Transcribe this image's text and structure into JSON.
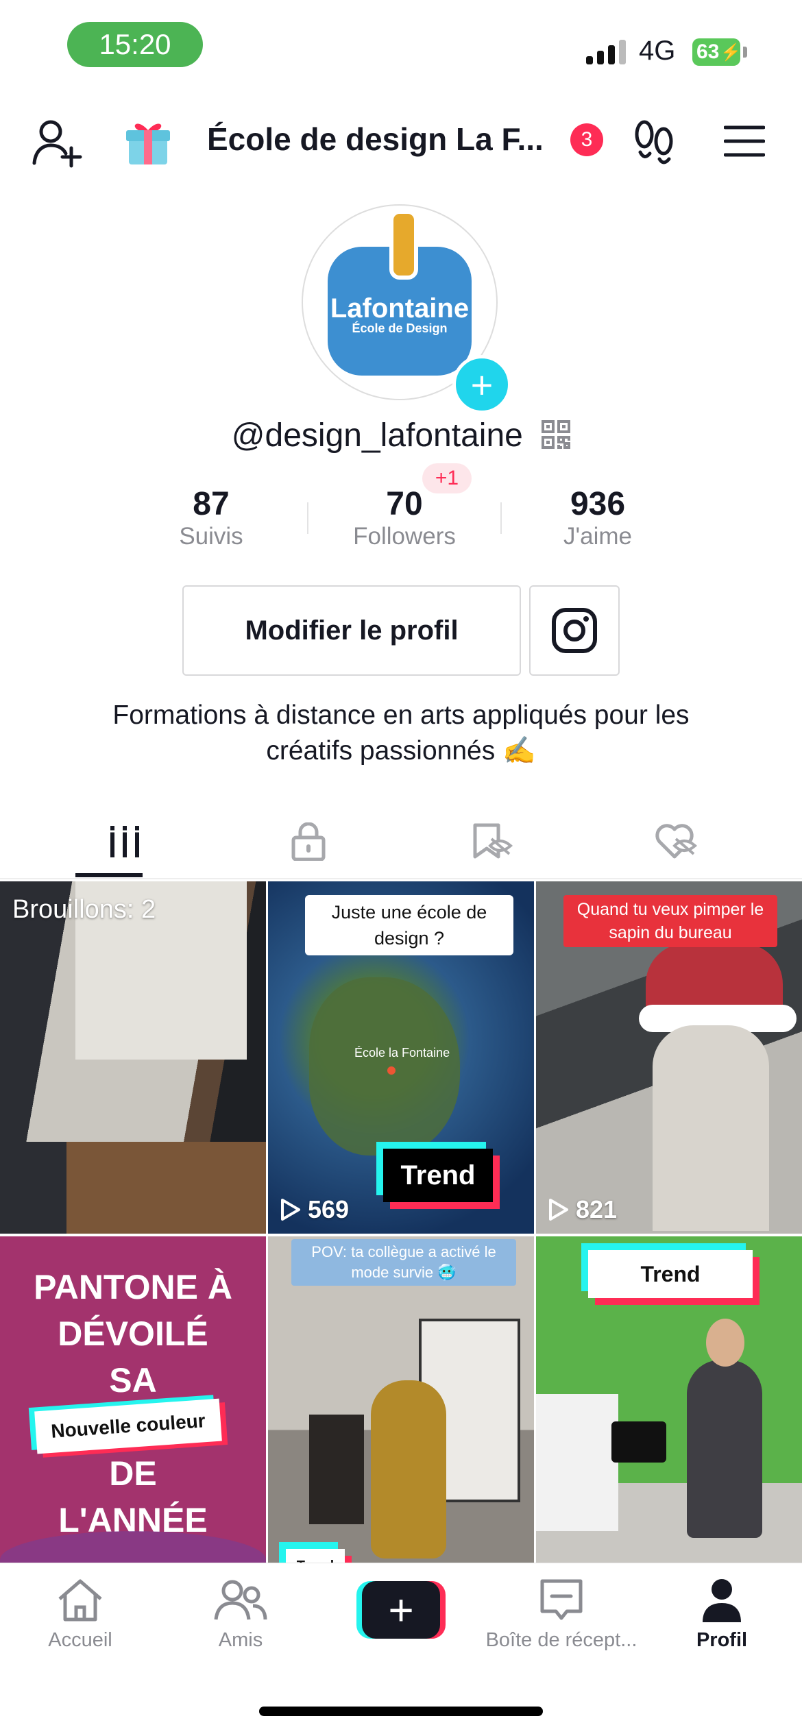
{
  "status_bar": {
    "time": "15:20",
    "network": "4G",
    "battery": "63"
  },
  "header": {
    "title": "École de design La F...",
    "notification_count": "3"
  },
  "profile": {
    "logo_name": "Lafontaine",
    "logo_sub": "École de Design",
    "username": "@design_lafontaine",
    "stats": [
      {
        "value": "87",
        "label": "Suivis"
      },
      {
        "value": "70",
        "label": "Followers",
        "delta": "+1"
      },
      {
        "value": "936",
        "label": "J'aime"
      }
    ],
    "edit_button": "Modifier le profil",
    "bio_line1": "Formations à distance en arts appliqués pour les",
    "bio_line2": "créatifs passionnés ✍️"
  },
  "tabs": [
    {
      "icon": "grid-icon",
      "active": true
    },
    {
      "icon": "lock-icon",
      "active": false
    },
    {
      "icon": "bookmark-hidden-icon",
      "active": false
    },
    {
      "icon": "heart-hidden-icon",
      "active": false
    }
  ],
  "videos": [
    {
      "overlay": "Brouillons: 2"
    },
    {
      "caption": "Juste une école de design ?",
      "map_label": "École la Fontaine",
      "badge": "Trend",
      "views": "569"
    },
    {
      "caption": "Quand tu veux pimper le sapin du bureau",
      "views": "821"
    },
    {
      "title_lines": [
        "PANTONE À",
        "DÉVOILÉ",
        "SA",
        "DE",
        "L'ANNÉE"
      ],
      "banner": "Nouvelle couleur"
    },
    {
      "caption": "POV: ta collègue a activé le mode survie 🥶",
      "badge": "Trend"
    },
    {
      "badge": "Trend"
    }
  ],
  "nav": [
    {
      "label": "Accueil",
      "icon": "home-icon"
    },
    {
      "label": "Amis",
      "icon": "friends-icon"
    },
    {
      "label": "",
      "icon": "create-icon"
    },
    {
      "label": "Boîte de récept...",
      "icon": "inbox-icon"
    },
    {
      "label": "Profil",
      "icon": "profile-icon",
      "active": true
    }
  ],
  "colors": {
    "accent_red": "#fe2c55",
    "accent_cyan": "#25f4ee",
    "status_green": "#4cb454"
  }
}
